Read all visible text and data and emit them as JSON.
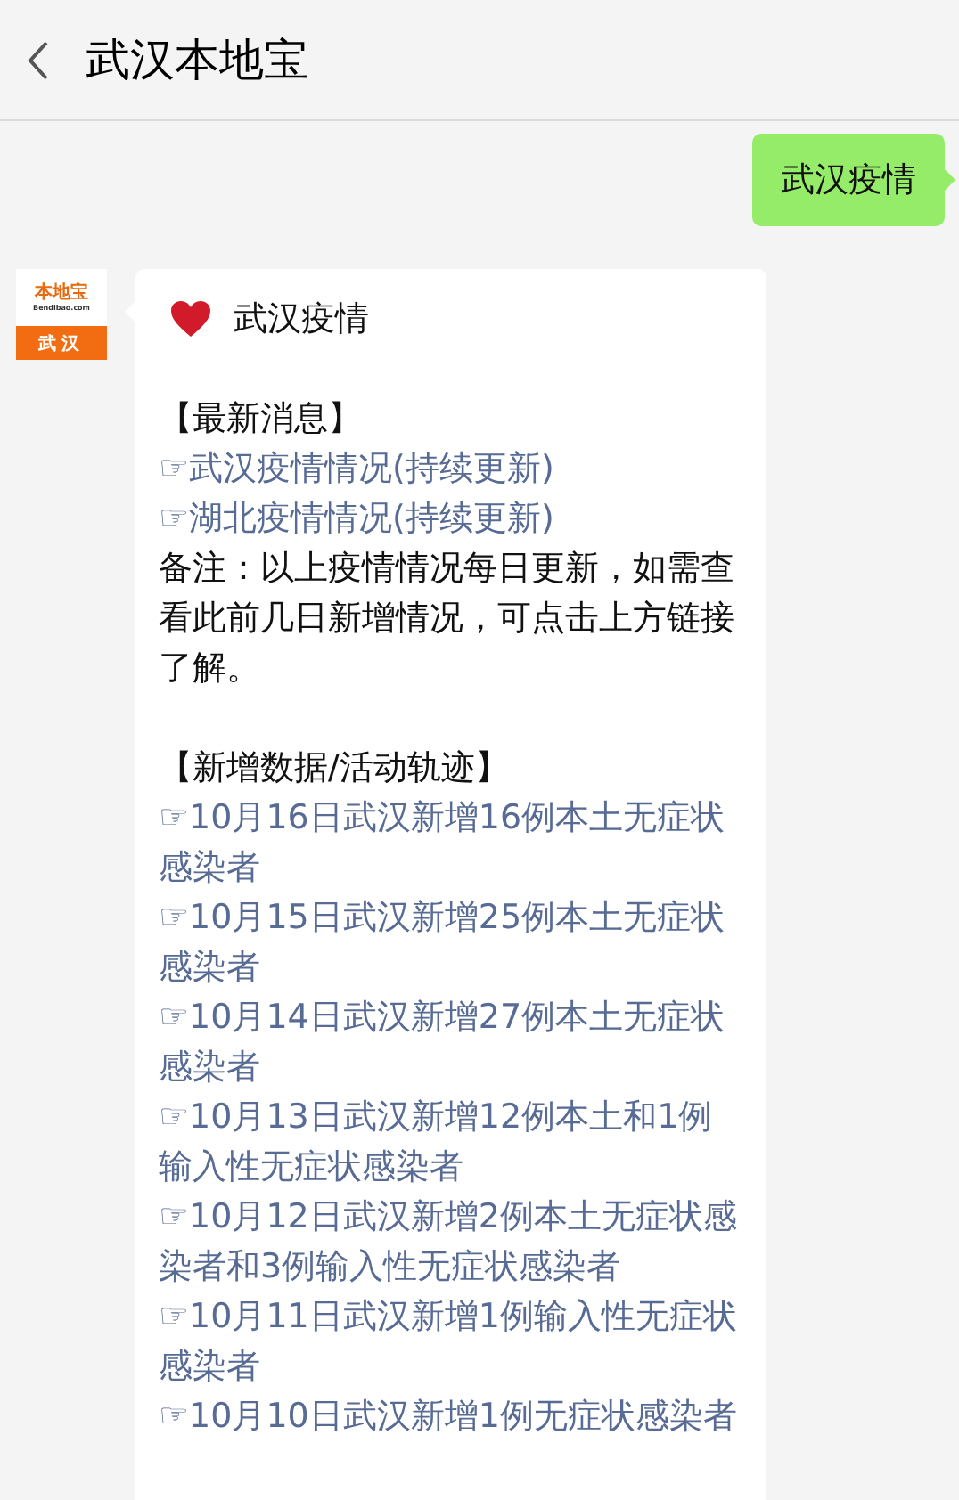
{
  "header": {
    "title": "武汉本地宝"
  },
  "sent_message": {
    "text": "武汉疫情"
  },
  "avatar": {
    "logo": "本地宝",
    "site": "Bendibao.com",
    "city": "武汉"
  },
  "card": {
    "title": "武汉疫情",
    "sections": [
      {
        "heading": "【最新消息】",
        "links": [
          "☞武汉疫情情况(持续更新)",
          "☞湖北疫情情况(持续更新)"
        ],
        "note": "备注：以上疫情情况每日更新，如需查看此前几日新增情况，可点击上方链接了解。"
      },
      {
        "heading": "【新增数据/活动轨迹】",
        "links": [
          "☞10月16日武汉新增16例本土无症状感染者",
          "☞10月15日武汉新增25例本土无症状感染者",
          "☞10月14日武汉新增27例本土无症状感染者",
          "☞10月13日武汉新增12例本土和1例输入性无症状感染者",
          "☞10月12日武汉新增2例本土无症状感染者和3例输入性无症状感染者",
          "☞10月11日武汉新增1例输入性无症状感染者",
          "☞10月10日武汉新增1例无症状感染者"
        ]
      }
    ]
  }
}
